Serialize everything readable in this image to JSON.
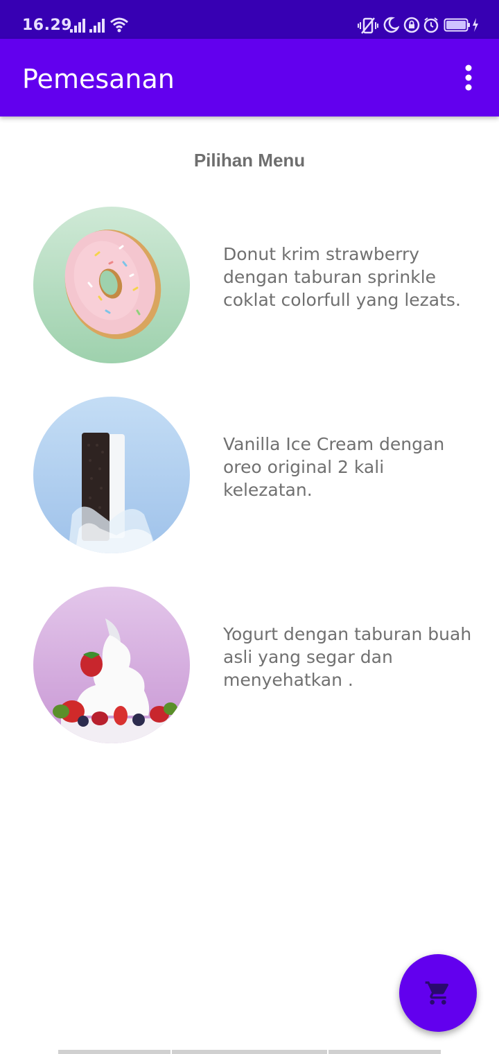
{
  "status_bar": {
    "time": "16.29",
    "icons": [
      "signal-icon",
      "signal-icon",
      "wifi-icon",
      "vibrate-icon",
      "moon-icon",
      "lock-rotation-icon",
      "alarm-icon",
      "battery-icon",
      "charging-icon"
    ]
  },
  "app_bar": {
    "title": "Pemesanan",
    "overflow_icon": "more-vert-icon"
  },
  "main": {
    "section_title": "Pilihan Menu",
    "items": [
      {
        "image": "donut-image",
        "description": "Donut krim strawberry dengan taburan sprinkle coklat colorfull yang lezats."
      },
      {
        "image": "ice-cream-sandwich-image",
        "description": "Vanilla Ice Cream dengan oreo original 2 kali kelezatan."
      },
      {
        "image": "yogurt-image",
        "description": "Yogurt dengan taburan buah asli yang segar dan menyehatkan ."
      }
    ]
  },
  "fab": {
    "icon": "cart-icon"
  },
  "colors": {
    "status_bar": "#3700b3",
    "app_bar": "#6200ee",
    "fab": "#6200ee",
    "text_gray": "#707070"
  }
}
